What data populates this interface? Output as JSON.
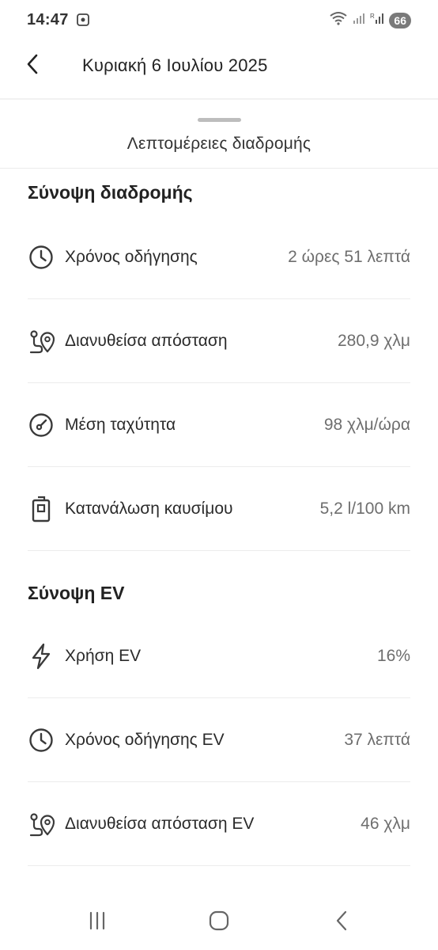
{
  "status_bar": {
    "time": "14:47",
    "battery": "66",
    "icons": [
      "screenshot-icon",
      "wifi-icon",
      "signal-icon",
      "signal-r-icon",
      "battery-icon"
    ]
  },
  "header": {
    "title": "Κυριακή 6 Ιουλίου 2025",
    "back_icon": "chevron-left-icon"
  },
  "sheet": {
    "title": "Λεπτομέρειες διαδρομής"
  },
  "trip_summary": {
    "title": "Σύνοψη διαδρομής",
    "rows": [
      {
        "icon": "clock-icon",
        "label": "Χρόνος οδήγησης",
        "value": "2 ώρες 51 λεπτά"
      },
      {
        "icon": "route-icon",
        "label": "Διανυθείσα απόσταση",
        "value": "280,9 χλμ"
      },
      {
        "icon": "speedometer-icon",
        "label": "Μέση ταχύτητα",
        "value": "98 χλμ/ώρα"
      },
      {
        "icon": "fuel-icon",
        "label": "Κατανάλωση καυσίμου",
        "value": "5,2 l/100 km"
      }
    ]
  },
  "ev_summary": {
    "title": "Σύνοψη EV",
    "rows": [
      {
        "icon": "lightning-icon",
        "label": "Χρήση EV",
        "value": "16%"
      },
      {
        "icon": "clock-icon",
        "label": "Χρόνος οδήγησης EV",
        "value": "37 λεπτά"
      },
      {
        "icon": "route-icon",
        "label": "Διανυθείσα απόσταση EV",
        "value": "46 χλμ"
      }
    ]
  },
  "nav_bar": {
    "items": [
      "recents-icon",
      "home-icon",
      "back-icon"
    ]
  },
  "colors": {
    "text": "#2b2b2b",
    "value": "#6e6e6e",
    "divider": "#ececec",
    "icon": "#3a3a3a"
  }
}
